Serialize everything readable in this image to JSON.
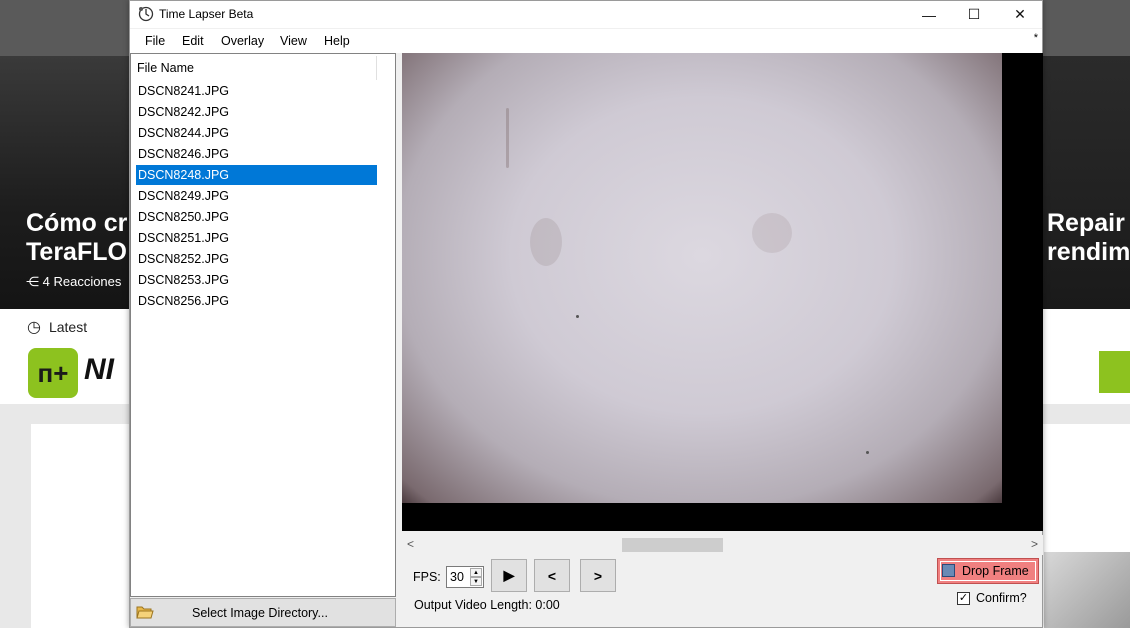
{
  "background": {
    "hero_left_text": [
      "Cómo cr",
      "TeraFLO"
    ],
    "hero_left_reactions": "4 Reacciones",
    "hero_right_text": [
      "Repair",
      "rendim"
    ],
    "nav_latest": "Latest",
    "logo_mark": "п+",
    "logo_text": "NI"
  },
  "window": {
    "title": "Time Lapser Beta",
    "controls": {
      "minimize": "—",
      "maximize": "☐",
      "close": "✕"
    }
  },
  "menu": {
    "items": [
      "File",
      "Edit",
      "Overlay",
      "View",
      "Help"
    ],
    "modified_marker": "*"
  },
  "file_list": {
    "header": "File Name",
    "selected_index": 4,
    "files": [
      "DSCN8241.JPG",
      "DSCN8242.JPG",
      "DSCN8244.JPG",
      "DSCN8246.JPG",
      "DSCN8248.JPG",
      "DSCN8249.JPG",
      "DSCN8250.JPG",
      "DSCN8251.JPG",
      "DSCN8252.JPG",
      "DSCN8253.JPG",
      "DSCN8256.JPG"
    ]
  },
  "select_directory": {
    "label": "Select Image Directory..."
  },
  "playback": {
    "fps_label": "FPS:",
    "fps_value": "30",
    "play_label": "▶",
    "prev_label": "<",
    "next_label": ">",
    "output_length": "Output Video Length: 0:00"
  },
  "drop_frame": {
    "label": "Drop Frame"
  },
  "confirm": {
    "label": "Confirm?",
    "checked": true
  },
  "colors": {
    "selection": "#0078d7",
    "drop_button": "#f08080"
  }
}
